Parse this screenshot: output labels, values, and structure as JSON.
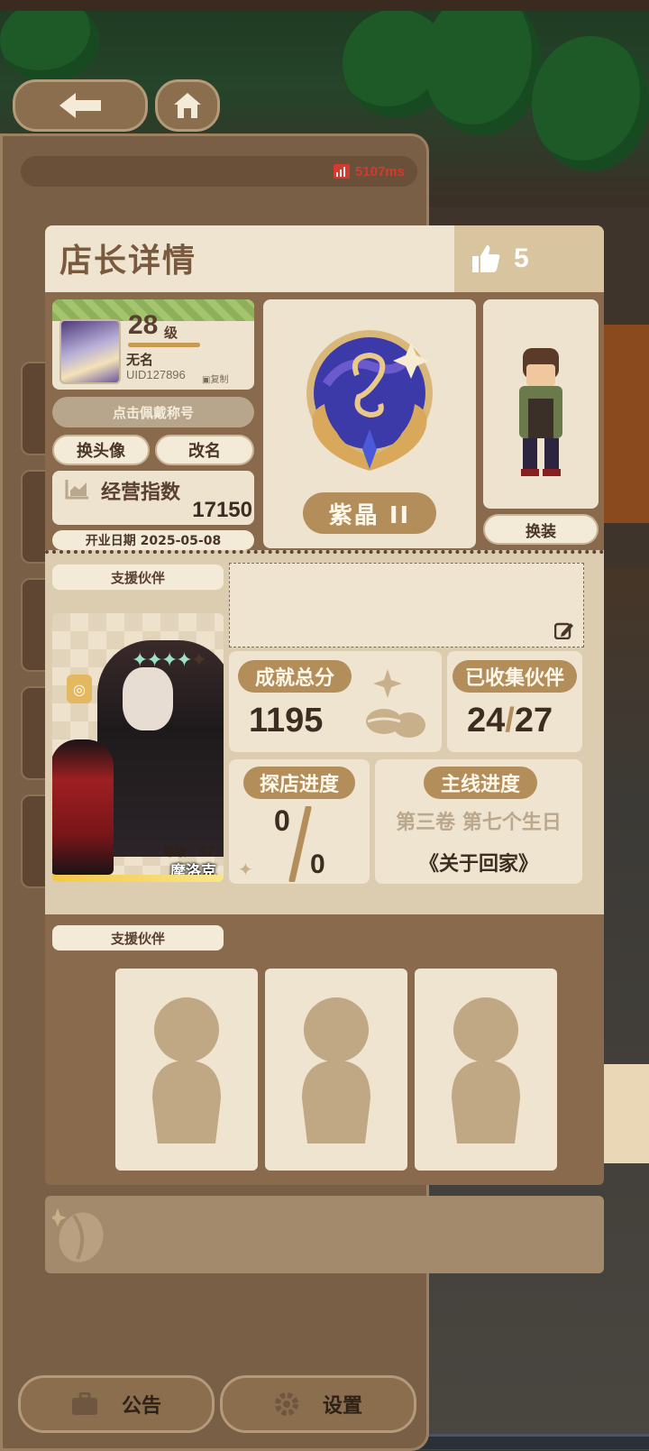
{
  "background": {
    "ping_text": "5107ms"
  },
  "bottom_bar": {
    "notice_label": "公告",
    "settings_label": "设置"
  },
  "modal": {
    "title": "店长详情",
    "likes": "5",
    "profile": {
      "level": "28",
      "level_unit": "级",
      "name": "无名",
      "uid": "UID127896",
      "copy_label": "复制"
    },
    "title_button": "点击佩戴称号",
    "change_avatar": "换头像",
    "rename": "改名",
    "business_index_label": "经营指数",
    "business_index_value": "17150",
    "open_date": "开业日期 2025-05-08",
    "rank": "紫晶 II",
    "outfit_button": "换装",
    "support_partner_label": "支援伙伴",
    "partner": {
      "level": "等级：57",
      "name": "摩洛克",
      "stars": 4
    },
    "stats": {
      "achievement_label": "成就总分",
      "achievement_value": "1195",
      "collected_label": "已收集伙伴",
      "collected_current": "24",
      "collected_total": "27",
      "explore_label": "探店进度",
      "explore_current": "0",
      "explore_total": "0",
      "main_label": "主线进度",
      "main_chapter": "第三卷 第七个生日",
      "main_title": "《关于回家》"
    },
    "support_partner_label_2": "支援伙伴"
  },
  "colors": {
    "panel_brown": "#8a6a4c",
    "cream": "#efe4d0",
    "label_gold": "#b48e5a",
    "ping_red": "#d23b2e"
  }
}
